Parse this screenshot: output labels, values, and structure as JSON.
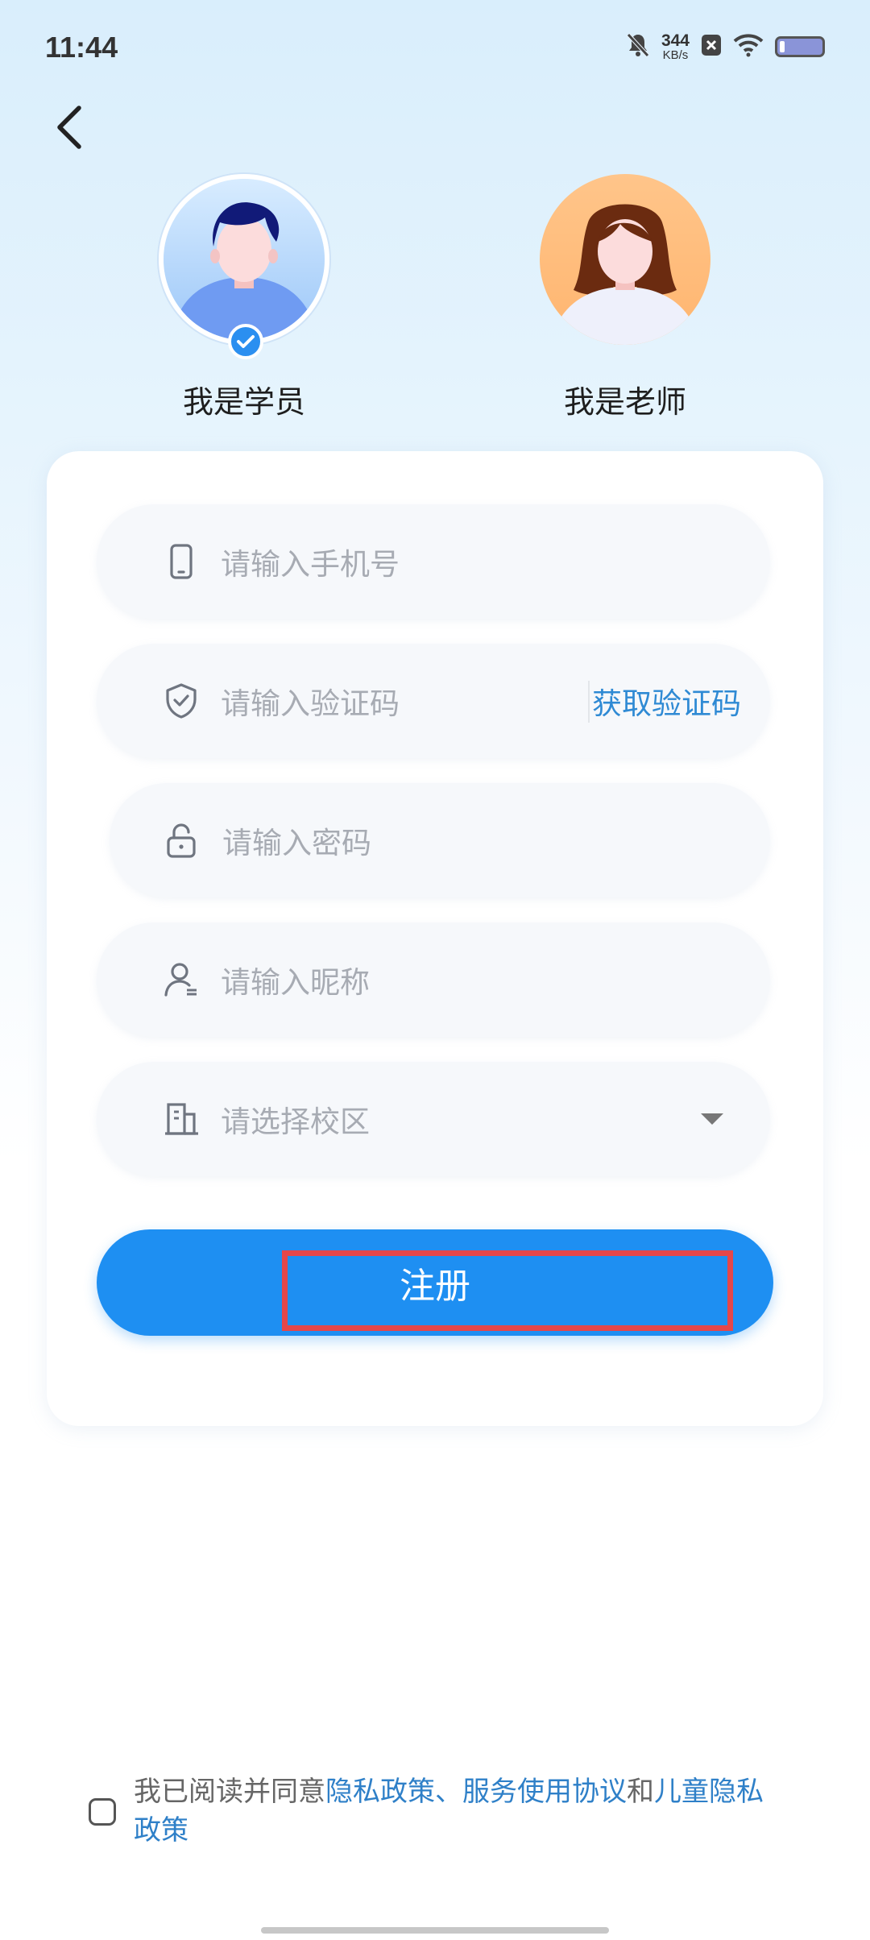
{
  "status_bar": {
    "time": "11:44",
    "net_speed_value": "344",
    "net_speed_unit": "KB/s",
    "icons": [
      "mute-bell-icon",
      "close-box-icon",
      "wifi-icon",
      "battery-icon"
    ]
  },
  "nav": {
    "back_icon": "chevron-left-icon"
  },
  "roles": {
    "student": {
      "label": "我是学员",
      "selected": true
    },
    "teacher": {
      "label": "我是老师",
      "selected": false
    }
  },
  "form": {
    "phone": {
      "placeholder": "请输入手机号",
      "icon": "phone-icon"
    },
    "code": {
      "placeholder": "请输入验证码",
      "icon": "shield-check-icon",
      "button": "获取验证码"
    },
    "password": {
      "placeholder": "请输入密码",
      "icon": "unlock-icon"
    },
    "nickname": {
      "placeholder": "请输入昵称",
      "icon": "user-icon"
    },
    "campus": {
      "placeholder": "请选择校区",
      "icon": "building-icon"
    },
    "register_label": "注册"
  },
  "agreement": {
    "prefix": "我已阅读并同意",
    "privacy": "隐私政策",
    "sep": "、",
    "service": "服务使用协议",
    "and": "和",
    "child_privacy": "儿童隐私政策",
    "checked": false
  },
  "colors": {
    "accent": "#1e8ff2",
    "link": "#2f80c8",
    "highlight": "#e5474a"
  }
}
